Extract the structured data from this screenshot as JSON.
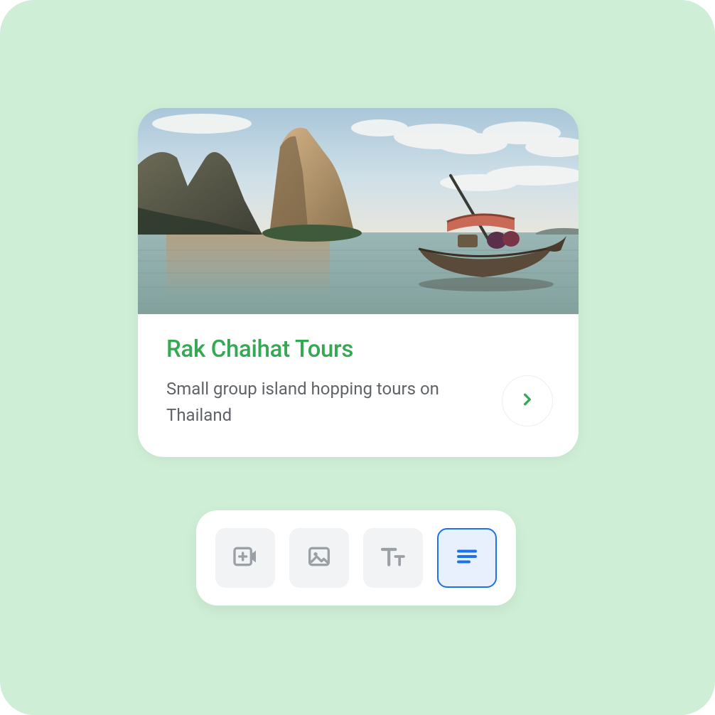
{
  "card": {
    "title": "Rak Chaihat Tours",
    "description": "Small group island hopping tours on Thailand",
    "image_alt": "Longtail boat on calm sea with limestone karst cliffs under a cloudy sky",
    "next_icon": "chevron-right"
  },
  "toolbar": {
    "items": [
      {
        "name": "add-video",
        "selected": false
      },
      {
        "name": "add-image",
        "selected": false
      },
      {
        "name": "text-style",
        "selected": false
      },
      {
        "name": "text-align",
        "selected": true
      }
    ]
  },
  "colors": {
    "background": "#ceeed6",
    "accent_green": "#34a853",
    "accent_blue": "#1a73e8",
    "muted_text": "#5f6368",
    "icon_grey": "#9aa0a6",
    "tool_bg": "#f1f3f4",
    "tool_selected_bg": "#e8f0fe"
  }
}
